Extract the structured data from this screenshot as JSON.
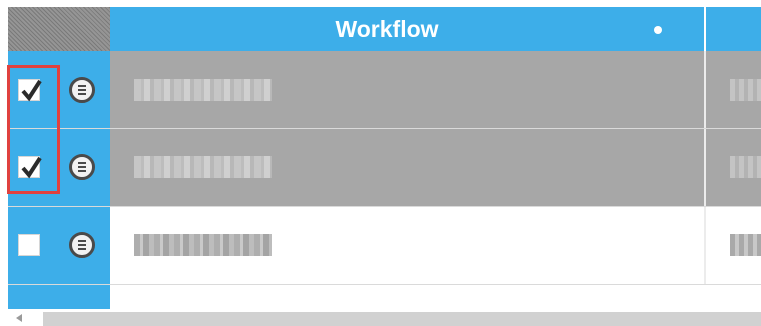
{
  "header": {
    "title": "Workflow"
  },
  "rows": [
    {
      "checked": true,
      "selected": true
    },
    {
      "checked": true,
      "selected": true
    },
    {
      "checked": false,
      "selected": false
    }
  ],
  "icons": {
    "checkbox": "checkbox-icon",
    "row_menu": "menu-lines-icon",
    "scroll_left": "chevron-left-icon"
  },
  "colors": {
    "accent": "#3daee9",
    "selected_row": "#a7a7a7",
    "highlight": "#e0413f"
  }
}
